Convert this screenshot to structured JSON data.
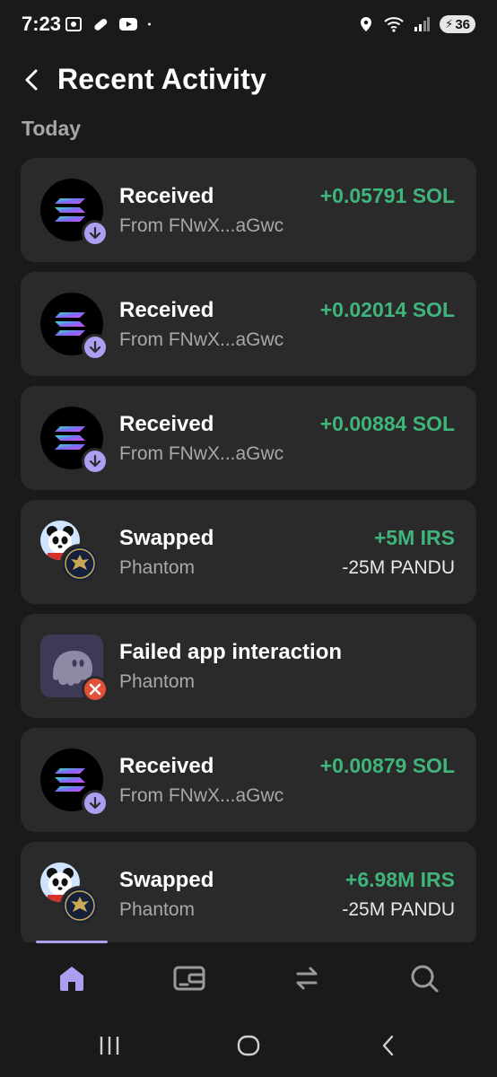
{
  "status_bar": {
    "time": "7:23",
    "battery": "36",
    "icons": [
      "screenshot-icon",
      "pill-icon",
      "youtube-icon",
      "dot-icon",
      "location-icon",
      "wifi-icon",
      "signal-icon",
      "battery-icon"
    ]
  },
  "header": {
    "title": "Recent Activity",
    "back_icon": "chevron-left-icon"
  },
  "section": {
    "label": "Today"
  },
  "activities": [
    {
      "type": "received",
      "title": "Received",
      "subtitle": "From FNwX...aGwc",
      "amount": "+0.05791 SOL",
      "secondary": ""
    },
    {
      "type": "received",
      "title": "Received",
      "subtitle": "From FNwX...aGwc",
      "amount": "+0.02014 SOL",
      "secondary": ""
    },
    {
      "type": "received",
      "title": "Received",
      "subtitle": "From FNwX...aGwc",
      "amount": "+0.00884 SOL",
      "secondary": ""
    },
    {
      "type": "swapped",
      "title": "Swapped",
      "subtitle": "Phantom",
      "amount": "+5M IRS",
      "secondary": "-25M PANDU"
    },
    {
      "type": "failed",
      "title": "Failed app interaction",
      "subtitle": "Phantom",
      "amount": "",
      "secondary": ""
    },
    {
      "type": "received",
      "title": "Received",
      "subtitle": "From FNwX...aGwc",
      "amount": "+0.00879 SOL",
      "secondary": ""
    },
    {
      "type": "swapped",
      "title": "Swapped",
      "subtitle": "Phantom",
      "amount": "+6.98M IRS",
      "secondary": "-25M PANDU"
    }
  ],
  "bottom_nav": {
    "items": [
      "home-icon",
      "wallet-card-icon",
      "swap-arrows-icon",
      "search-icon"
    ],
    "active": "home-icon"
  },
  "colors": {
    "background": "#1a1a1a",
    "card": "#2a2a2a",
    "positive": "#3fb57c",
    "accent": "#ab9ff2",
    "muted_text": "#a8a8a8"
  }
}
